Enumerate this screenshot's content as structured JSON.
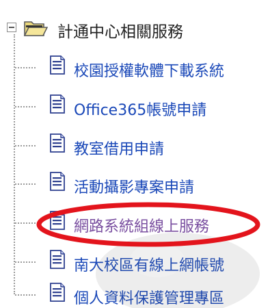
{
  "tree": {
    "root": {
      "label": "計通中心相關服務",
      "expander_icon": "collapse-minus-icon",
      "folder_icon": "folder-open-icon"
    },
    "items": [
      {
        "label": "校園授權軟體下載系統",
        "icon": "document-icon"
      },
      {
        "label": "Office365帳號申請",
        "icon": "document-icon"
      },
      {
        "label": "教室借用申請",
        "icon": "document-icon"
      },
      {
        "label": "活動攝影專案申請",
        "icon": "document-icon"
      },
      {
        "label": "網路系統組線上服務",
        "icon": "document-icon",
        "highlighted": true
      },
      {
        "label": "南大校區有線上網帳號",
        "icon": "document-icon"
      },
      {
        "label": "個人資料保護管理專區",
        "icon": "document-icon"
      }
    ]
  },
  "colors": {
    "link": "#1a48b8",
    "visited_link": "#7a4fa0",
    "highlight_oval": "#e3141c",
    "root_text": "#222222"
  }
}
